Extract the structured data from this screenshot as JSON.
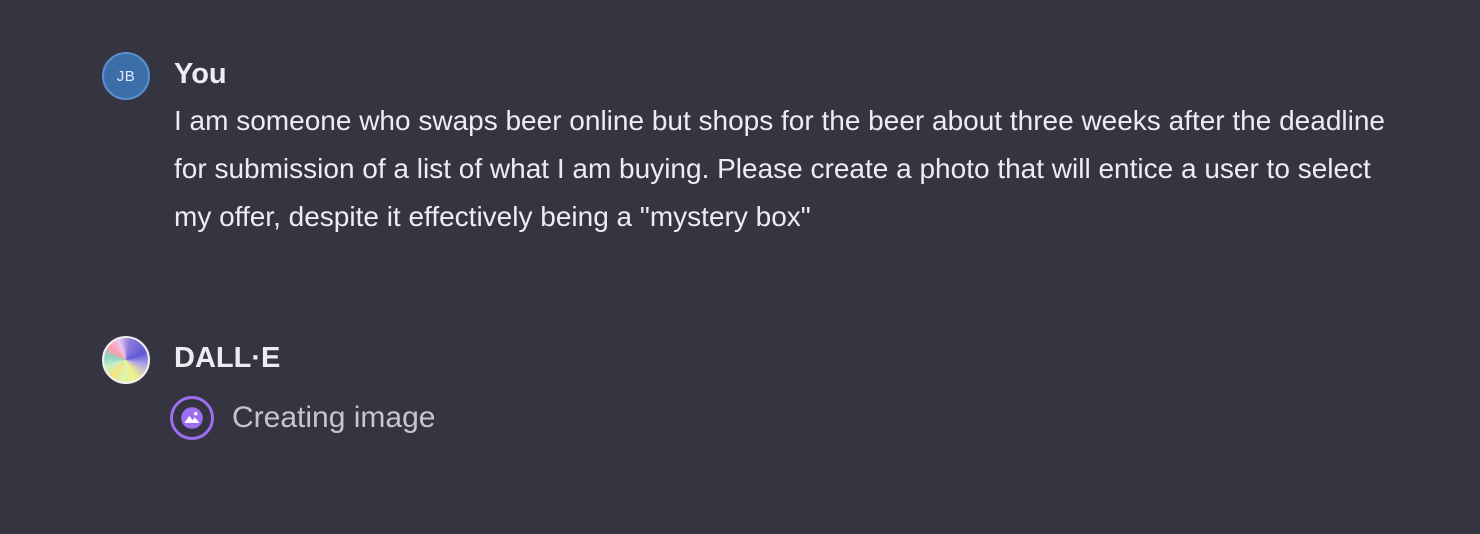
{
  "messages": {
    "user": {
      "avatar_initials": "JB",
      "author": "You",
      "text": "I am someone who swaps beer online but shops for the beer about three weeks after the deadline for submission of a list of what I am buying. Please create a photo that will entice a user to select my offer, despite it effectively being a \"mystery box\""
    },
    "assistant": {
      "author": "DALL·E",
      "status_icon": "image-icon",
      "status_text": "Creating image"
    }
  },
  "colors": {
    "background": "#343541",
    "user_avatar": "#3c6ea8",
    "status_accent": "#9d6ef0",
    "text": "#ececf1"
  }
}
